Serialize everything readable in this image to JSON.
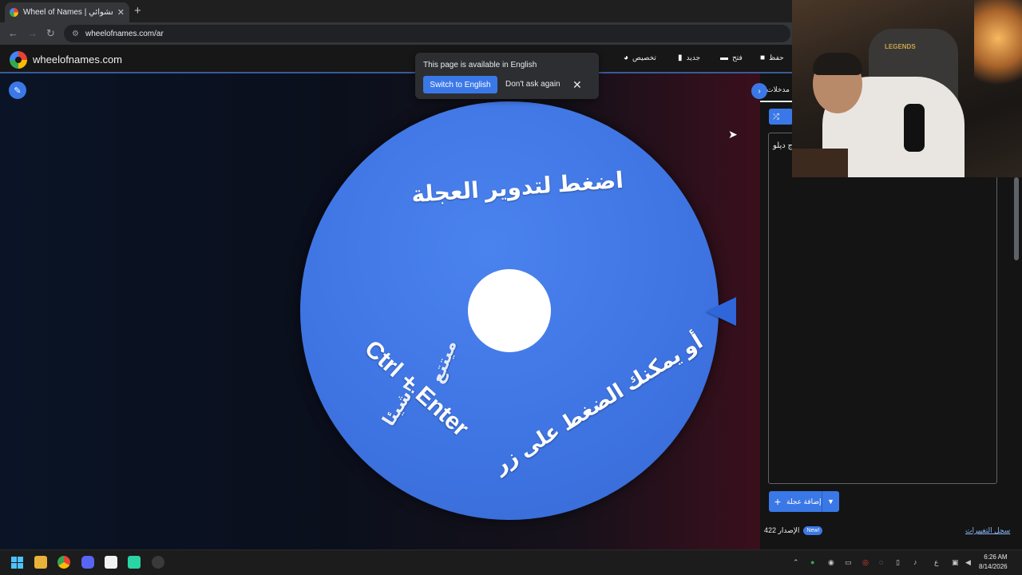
{
  "browser": {
    "tab_title": "Wheel of Names | اسم العشوائي",
    "tab_close": "✕",
    "new_tab": "+",
    "url": "wheelofnames.com/ar",
    "back": "←",
    "forward": "→",
    "reload": "↻"
  },
  "site": {
    "name": "wheelofnames.com",
    "header_buttons": [
      {
        "label": "تخصيص",
        "icon": "palette-icon"
      },
      {
        "label": "جديد",
        "icon": "file-icon"
      },
      {
        "label": "فتح",
        "icon": "folder-icon"
      },
      {
        "label": "حفظ",
        "icon": "save-icon"
      }
    ]
  },
  "translate_popup": {
    "message": "This page is available in English",
    "switch_label": "Switch to English",
    "dont_ask_label": "Don't ask again",
    "close": "✕"
  },
  "wheel": {
    "text_top": "اضغط لتدوير العجلة",
    "text_ctrl": "Ctrl + Enter",
    "text_bottom": "أو يمكنك الضغط على زر",
    "text_faint1": "شيئا!",
    "text_faint2": "ميتتع"
  },
  "panel": {
    "entries_tab": "مدخلات",
    "entry_text": "ج ديلو",
    "add_wheel_label": "إضافة عجلة",
    "version_label": "الإصدار 422",
    "new_badge": "New!",
    "changelog_label": "سجل التغييرات"
  },
  "webcam": {
    "chair_brand": "LEGENDS"
  },
  "taskbar": {
    "time": "6:26 AM",
    "date": "8/14/2026",
    "lang": "ع"
  },
  "colors": {
    "accent": "#3b78e7",
    "wheel": "#3f75e3"
  }
}
